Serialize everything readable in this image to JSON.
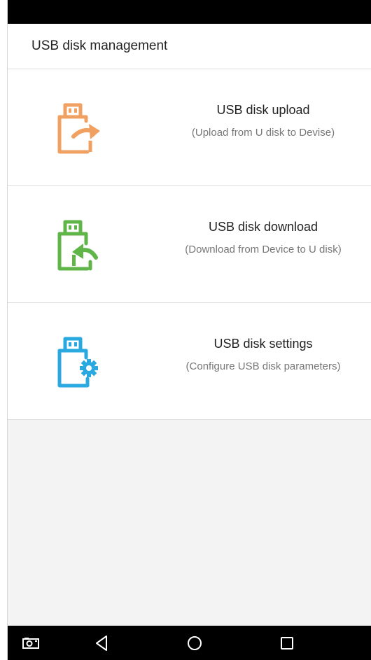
{
  "header": {
    "title": "USB disk management"
  },
  "items": [
    {
      "label": "USB disk upload",
      "desc": "(Upload from U disk to Devise)",
      "color": "#f0a061"
    },
    {
      "label": "USB disk download",
      "desc": "(Download from Device to U disk)",
      "color": "#5fb547"
    },
    {
      "label": "USB disk settings",
      "desc": "(Configure USB disk parameters)",
      "color": "#2aa9e0"
    }
  ],
  "nav": {
    "icons": [
      "screenshot-icon",
      "back-icon",
      "home-icon",
      "recents-icon"
    ]
  }
}
